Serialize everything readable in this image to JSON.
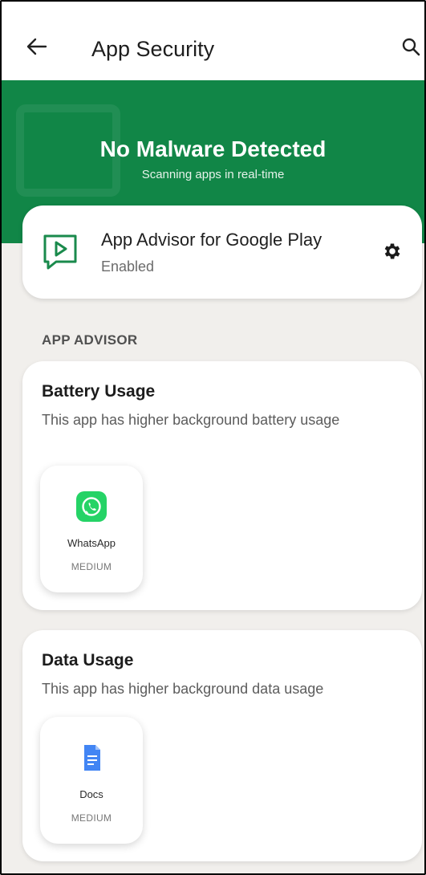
{
  "appbar": {
    "title": "App Security"
  },
  "hero": {
    "title": "No Malware Detected",
    "subtitle": "Scanning apps in real-time",
    "color": "#118647"
  },
  "advisor": {
    "name": "App Advisor for Google Play",
    "status": "Enabled",
    "icon": "play-advisor-icon"
  },
  "section_header": "APP ADVISOR",
  "cards": [
    {
      "title": "Battery Usage",
      "description": "This app has higher background battery usage",
      "app": {
        "name": "WhatsApp",
        "level": "MEDIUM",
        "icon": "whatsapp-icon",
        "color": "#25d366"
      }
    },
    {
      "title": "Data Usage",
      "description": "This app has higher background data usage",
      "app": {
        "name": "Docs",
        "level": "MEDIUM",
        "icon": "docs-icon",
        "color": "#4285f4"
      }
    }
  ]
}
